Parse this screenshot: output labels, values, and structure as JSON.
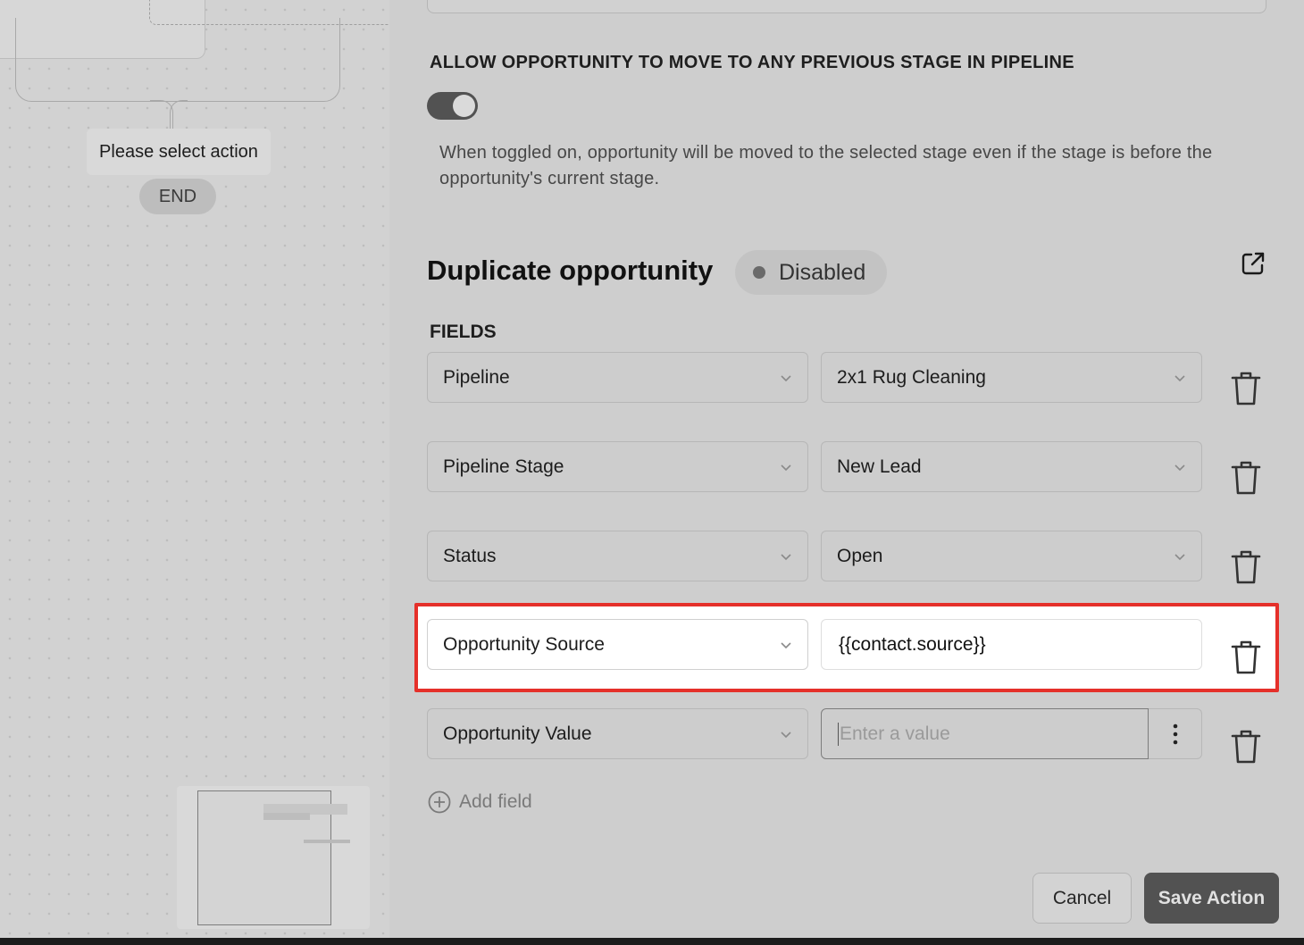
{
  "canvas": {
    "action_node_label": "Please select action",
    "end_label": "END"
  },
  "settings": {
    "allow_previous_stage_heading": "ALLOW OPPORTUNITY TO MOVE TO ANY PREVIOUS STAGE IN PIPELINE",
    "allow_previous_stage_enabled": true,
    "allow_previous_stage_help": "When toggled on, opportunity will be moved to the selected stage even if the stage is before the opportunity's current stage."
  },
  "duplicate": {
    "title": "Duplicate opportunity",
    "status": "Disabled",
    "open_icon": "external-link-icon"
  },
  "fields": {
    "label": "FIELDS",
    "rows": [
      {
        "field": "Pipeline",
        "value": "2x1 Rug Cleaning"
      },
      {
        "field": "Pipeline Stage",
        "value": "New Lead"
      },
      {
        "field": "Status",
        "value": "Open"
      },
      {
        "field": "Opportunity Source",
        "value": "{{contact.source}}"
      },
      {
        "field": "Opportunity Value",
        "value": "",
        "placeholder": "Enter a value"
      }
    ],
    "add_label": "Add field"
  },
  "footer": {
    "cancel": "Cancel",
    "save": "Save Action"
  },
  "colors": {
    "highlight_border": "#e5302a",
    "save_button": "#525252"
  }
}
